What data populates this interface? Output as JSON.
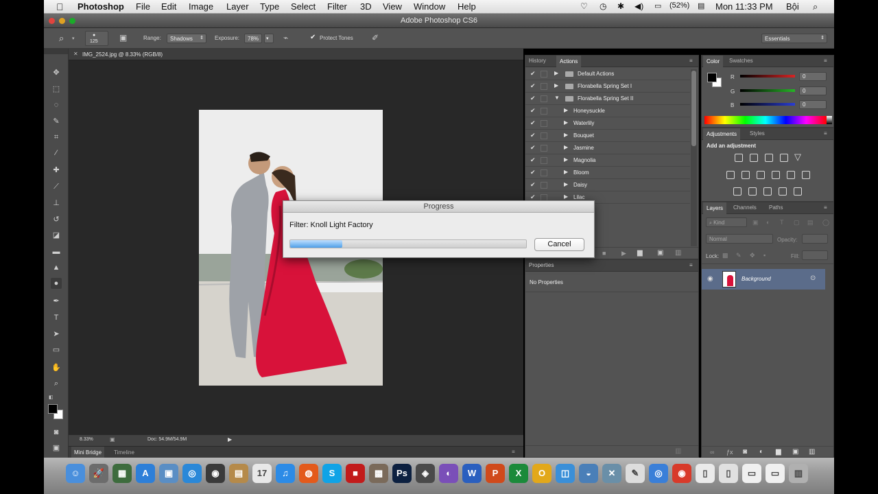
{
  "menubar": {
    "apple": "",
    "app": "Photoshop",
    "items": [
      "File",
      "Edit",
      "Image",
      "Layer",
      "Type",
      "Select",
      "Filter",
      "3D",
      "View",
      "Window",
      "Help"
    ],
    "battery": "(52%)",
    "clock": "Mon 11:33 PM",
    "user": "Bội"
  },
  "window": {
    "title": "Adobe Photoshop CS6"
  },
  "options": {
    "brush_size": "125",
    "range_label": "Range:",
    "range_value": "Shadows",
    "exposure_label": "Exposure:",
    "exposure_value": "78%",
    "protect_tones": "Protect Tones",
    "workspace": "Essentials"
  },
  "document": {
    "tab": "IMG_2524.jpg @ 8.33% (RGB/8)",
    "zoom": "8.33%",
    "doc_info": "Doc: 54.9M/54.9M",
    "bottom_tabs": [
      "Mini Bridge",
      "Timeline"
    ]
  },
  "actions_panel": {
    "tabs": [
      "History",
      "Actions"
    ],
    "rows": [
      {
        "label": "Default Actions",
        "type": "set"
      },
      {
        "label": "Florabella Spring Set I",
        "type": "set"
      },
      {
        "label": "Florabella Spring Set II",
        "type": "set-open"
      },
      {
        "label": "Honeysuckle",
        "type": "action"
      },
      {
        "label": "Waterlily",
        "type": "action"
      },
      {
        "label": "Bouquet",
        "type": "action"
      },
      {
        "label": "Jasmine",
        "type": "action"
      },
      {
        "label": "Magnolia",
        "type": "action"
      },
      {
        "label": "Bloom",
        "type": "action"
      },
      {
        "label": "Daisy",
        "type": "action"
      },
      {
        "label": "Lilac",
        "type": "action"
      }
    ]
  },
  "properties_panel": {
    "tab": "Properties",
    "body": "No Properties"
  },
  "color_panel": {
    "tabs": [
      "Color",
      "Swatches"
    ],
    "channels": [
      {
        "name": "R",
        "value": "0",
        "color": "#d82424"
      },
      {
        "name": "G",
        "value": "0",
        "color": "#26b526"
      },
      {
        "name": "B",
        "value": "0",
        "color": "#2a3dd4"
      }
    ]
  },
  "adjustments_panel": {
    "tabs": [
      "Adjustments",
      "Styles"
    ],
    "heading": "Add an adjustment"
  },
  "layers_panel": {
    "tabs": [
      "Layers",
      "Channels",
      "Paths"
    ],
    "filter": "Kind",
    "blend": "Normal",
    "opacity_label": "Opacity:",
    "lock_label": "Lock:",
    "fill_label": "Fill:",
    "layer_name": "Background"
  },
  "dialog": {
    "title": "Progress",
    "message": "Filter: Knoll Light Factory",
    "progress": 0.22,
    "cancel": "Cancel"
  },
  "dock": {
    "icons": [
      {
        "name": "finder-icon",
        "color": "#4a8fdc",
        "glyph": "☺"
      },
      {
        "name": "launchpad-icon",
        "color": "#6c6c6c",
        "glyph": "🚀"
      },
      {
        "name": "mission-control-icon",
        "color": "#3d6c3d",
        "glyph": "▦"
      },
      {
        "name": "app-store-icon",
        "color": "#2d7fd8",
        "glyph": "A"
      },
      {
        "name": "preview-icon",
        "color": "#5a8ec4",
        "glyph": "▣"
      },
      {
        "name": "safari-icon",
        "color": "#2a88d8",
        "glyph": "◎"
      },
      {
        "name": "facetime-icon",
        "color": "#3a3a3a",
        "glyph": "◉"
      },
      {
        "name": "contacts-icon",
        "color": "#b58a4a",
        "glyph": "▤"
      },
      {
        "name": "calendar-icon",
        "color": "#e8e8e8",
        "glyph": "17"
      },
      {
        "name": "itunes-icon",
        "color": "#2c8be6",
        "glyph": "♫"
      },
      {
        "name": "firefox-icon",
        "color": "#e35a1b",
        "glyph": "◍"
      },
      {
        "name": "skype-icon",
        "color": "#10a3e6",
        "glyph": "S"
      },
      {
        "name": "flashcard-icon",
        "color": "#c21b1b",
        "glyph": "■"
      },
      {
        "name": "photo-app-icon",
        "color": "#7a6a5a",
        "glyph": "▩"
      },
      {
        "name": "photoshop-icon",
        "color": "#0c2040",
        "glyph": "Ps"
      },
      {
        "name": "photo-booth-icon",
        "color": "#4a4a4a",
        "glyph": "◈"
      },
      {
        "name": "utility-icon",
        "color": "#7a4fb8",
        "glyph": "◐"
      },
      {
        "name": "word-icon",
        "color": "#2a5fbf",
        "glyph": "W"
      },
      {
        "name": "powerpoint-icon",
        "color": "#d04a1b",
        "glyph": "P"
      },
      {
        "name": "excel-icon",
        "color": "#1b8a3a",
        "glyph": "X"
      },
      {
        "name": "outlook-icon",
        "color": "#e2a81b",
        "glyph": "O"
      },
      {
        "name": "office-icon",
        "color": "#3a8fd8",
        "glyph": "◫"
      },
      {
        "name": "network-icon",
        "color": "#4a7fb8",
        "glyph": "◒"
      },
      {
        "name": "tools-icon",
        "color": "#6a8fa8",
        "glyph": "✕"
      },
      {
        "name": "script-icon",
        "color": "#ddd",
        "glyph": "✎"
      },
      {
        "name": "browser-icon",
        "color": "#3a7fd8",
        "glyph": "◎"
      },
      {
        "name": "chrome-icon",
        "color": "#d83a2a",
        "glyph": "◉"
      },
      {
        "name": "document-icon",
        "color": "#eaeaea",
        "glyph": "▯"
      },
      {
        "name": "doc-preview-icon",
        "color": "#e0e0e0",
        "glyph": "▯"
      },
      {
        "name": "stack-icon",
        "color": "#f0f0f0",
        "glyph": "▭"
      },
      {
        "name": "folder-stack-icon",
        "color": "#f0f0f0",
        "glyph": "▭"
      },
      {
        "name": "trash-icon",
        "color": "#b0b0b0",
        "glyph": "▥"
      }
    ]
  }
}
